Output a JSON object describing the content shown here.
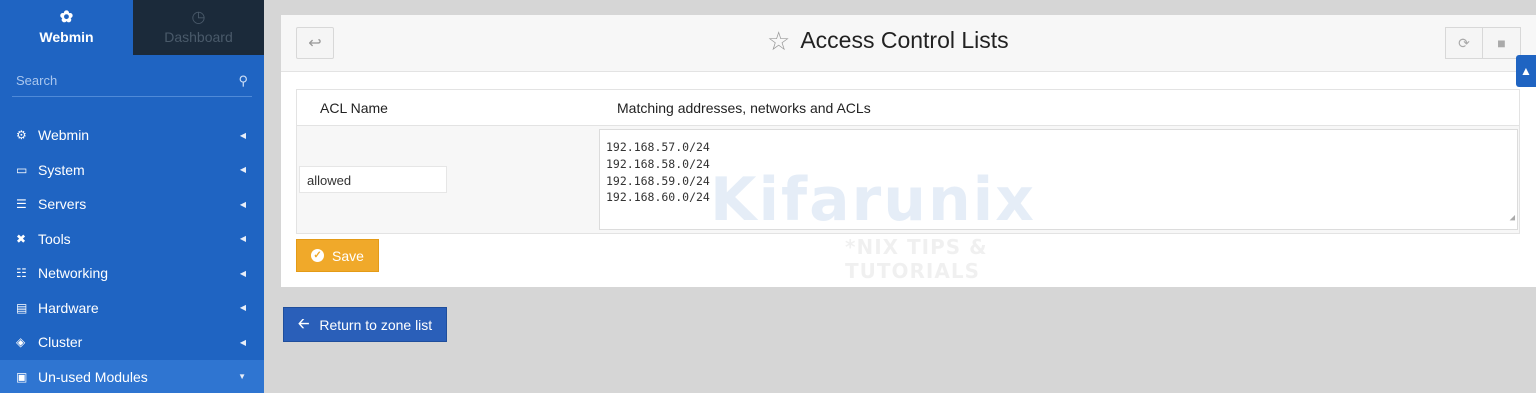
{
  "sidebar": {
    "tabs": [
      {
        "label": "Webmin",
        "icon": "webmin-logo-icon"
      },
      {
        "label": "Dashboard",
        "icon": "dashboard-gauge-icon"
      }
    ],
    "search_placeholder": "Search",
    "items": [
      {
        "label": "Webmin",
        "icon": "gear-icon"
      },
      {
        "label": "System",
        "icon": "laptop-icon"
      },
      {
        "label": "Servers",
        "icon": "server-icon"
      },
      {
        "label": "Tools",
        "icon": "tools-icon"
      },
      {
        "label": "Networking",
        "icon": "network-icon"
      },
      {
        "label": "Hardware",
        "icon": "hard-drive-icon"
      },
      {
        "label": "Cluster",
        "icon": "layers-icon"
      },
      {
        "label": "Un-used Modules",
        "icon": "puzzle-icon"
      }
    ]
  },
  "header": {
    "title": "Access Control Lists"
  },
  "table": {
    "columns": [
      "ACL Name",
      "Matching addresses, networks and ACLs"
    ],
    "rows": [
      {
        "name": "allowed",
        "addresses": [
          "192.168.57.0/24",
          "192.168.58.0/24",
          "192.168.59.0/24",
          "192.168.60.0/24"
        ]
      }
    ]
  },
  "buttons": {
    "save": "Save",
    "return": "Return to zone list"
  },
  "watermark": {
    "text": "Kifarunix",
    "subtitle": "*NIX TIPS & TUTORIALS"
  },
  "colors": {
    "sidebar_bg": "#1f64c2",
    "save_button": "#f0a92a",
    "return_button": "#2a5fb9"
  }
}
